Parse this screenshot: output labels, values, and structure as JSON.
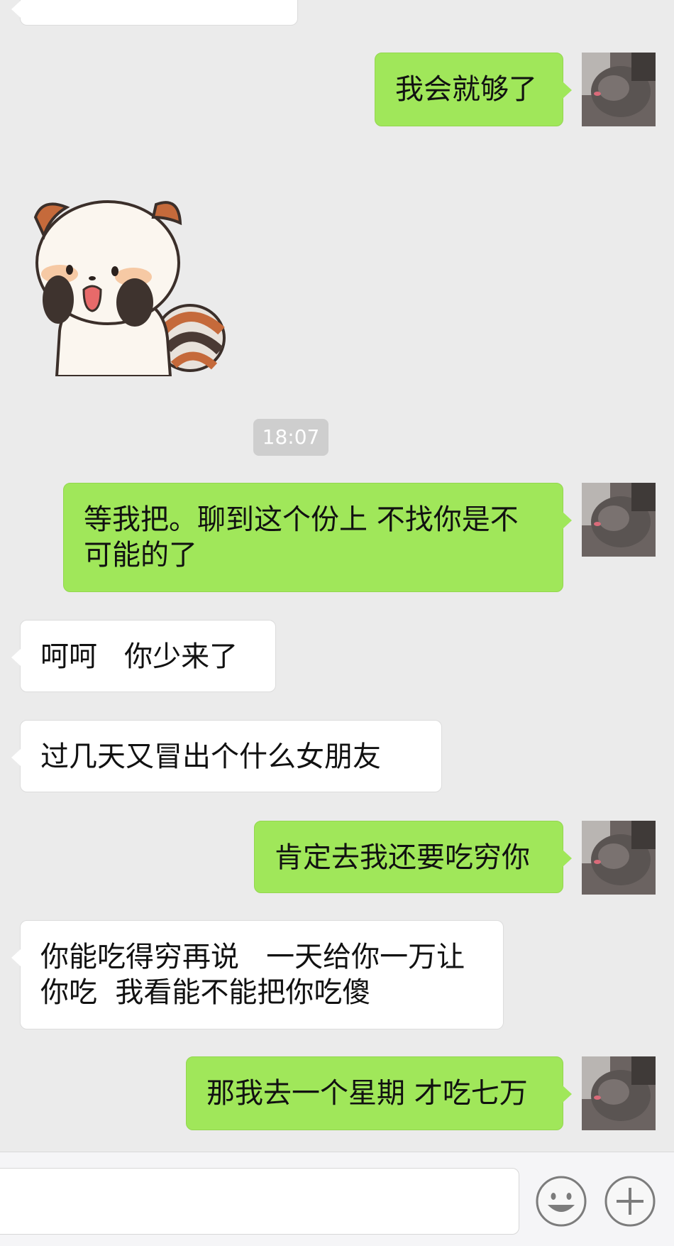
{
  "chat": {
    "top_partial_text": "",
    "timestamp": "18:07",
    "messages": [
      {
        "id": "m1",
        "sender": "me",
        "text": "我会就够了"
      },
      {
        "id": "m2",
        "sender": "me",
        "text": "等我把。聊到这个份上 不找你是不可能的了"
      },
      {
        "id": "m3",
        "sender": "other",
        "text": "呵呵   你少来了"
      },
      {
        "id": "m4",
        "sender": "other",
        "text": "过几天又冒出个什么女朋友"
      },
      {
        "id": "m5",
        "sender": "me",
        "text": "肯定去我还要吃穷你"
      },
      {
        "id": "m6",
        "sender": "other",
        "text": "你能吃得穷再说   一天给你一万让你吃  我看能不能把你吃傻"
      },
      {
        "id": "m7",
        "sender": "me",
        "text": "那我去一个星期 才吃七万"
      }
    ]
  },
  "input": {
    "placeholder": "",
    "emoji_icon": "smiley-face-icon",
    "plus_icon": "plus-icon"
  },
  "colors": {
    "background": "#ebebeb",
    "my_bubble": "#a0e75a",
    "their_bubble": "#ffffff"
  }
}
